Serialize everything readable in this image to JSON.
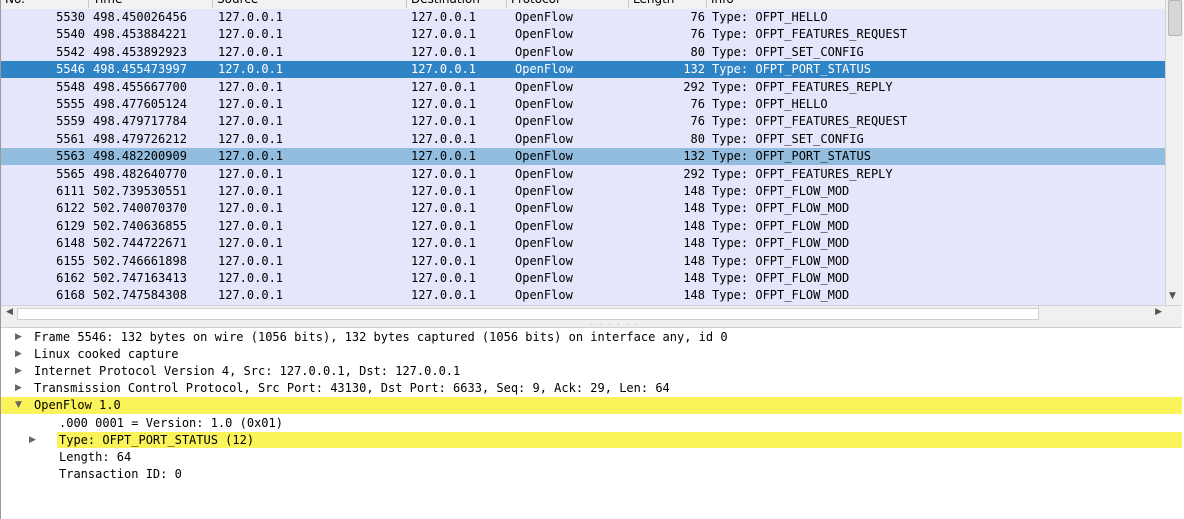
{
  "columns": [
    "No.",
    "Time",
    "Source",
    "Destination",
    "Protocol",
    "Length",
    "Info"
  ],
  "packets": [
    {
      "no": "5530",
      "time": "498.450026456",
      "src": "127.0.0.1",
      "dst": "127.0.0.1",
      "proto": "OpenFlow",
      "len": "76",
      "info": "Type: OFPT_HELLO"
    },
    {
      "no": "5540",
      "time": "498.453884221",
      "src": "127.0.0.1",
      "dst": "127.0.0.1",
      "proto": "OpenFlow",
      "len": "76",
      "info": "Type: OFPT_FEATURES_REQUEST"
    },
    {
      "no": "5542",
      "time": "498.453892923",
      "src": "127.0.0.1",
      "dst": "127.0.0.1",
      "proto": "OpenFlow",
      "len": "80",
      "info": "Type: OFPT_SET_CONFIG"
    },
    {
      "no": "5546",
      "time": "498.455473997",
      "src": "127.0.0.1",
      "dst": "127.0.0.1",
      "proto": "OpenFlow",
      "len": "132",
      "info": "Type: OFPT_PORT_STATUS"
    },
    {
      "no": "5548",
      "time": "498.455667700",
      "src": "127.0.0.1",
      "dst": "127.0.0.1",
      "proto": "OpenFlow",
      "len": "292",
      "info": "Type: OFPT_FEATURES_REPLY"
    },
    {
      "no": "5555",
      "time": "498.477605124",
      "src": "127.0.0.1",
      "dst": "127.0.0.1",
      "proto": "OpenFlow",
      "len": "76",
      "info": "Type: OFPT_HELLO"
    },
    {
      "no": "5559",
      "time": "498.479717784",
      "src": "127.0.0.1",
      "dst": "127.0.0.1",
      "proto": "OpenFlow",
      "len": "76",
      "info": "Type: OFPT_FEATURES_REQUEST"
    },
    {
      "no": "5561",
      "time": "498.479726212",
      "src": "127.0.0.1",
      "dst": "127.0.0.1",
      "proto": "OpenFlow",
      "len": "80",
      "info": "Type: OFPT_SET_CONFIG"
    },
    {
      "no": "5563",
      "time": "498.482200909",
      "src": "127.0.0.1",
      "dst": "127.0.0.1",
      "proto": "OpenFlow",
      "len": "132",
      "info": "Type: OFPT_PORT_STATUS"
    },
    {
      "no": "5565",
      "time": "498.482640770",
      "src": "127.0.0.1",
      "dst": "127.0.0.1",
      "proto": "OpenFlow",
      "len": "292",
      "info": "Type: OFPT_FEATURES_REPLY"
    },
    {
      "no": "6111",
      "time": "502.739530551",
      "src": "127.0.0.1",
      "dst": "127.0.0.1",
      "proto": "OpenFlow",
      "len": "148",
      "info": "Type: OFPT_FLOW_MOD"
    },
    {
      "no": "6122",
      "time": "502.740070370",
      "src": "127.0.0.1",
      "dst": "127.0.0.1",
      "proto": "OpenFlow",
      "len": "148",
      "info": "Type: OFPT_FLOW_MOD"
    },
    {
      "no": "6129",
      "time": "502.740636855",
      "src": "127.0.0.1",
      "dst": "127.0.0.1",
      "proto": "OpenFlow",
      "len": "148",
      "info": "Type: OFPT_FLOW_MOD"
    },
    {
      "no": "6148",
      "time": "502.744722671",
      "src": "127.0.0.1",
      "dst": "127.0.0.1",
      "proto": "OpenFlow",
      "len": "148",
      "info": "Type: OFPT_FLOW_MOD"
    },
    {
      "no": "6155",
      "time": "502.746661898",
      "src": "127.0.0.1",
      "dst": "127.0.0.1",
      "proto": "OpenFlow",
      "len": "148",
      "info": "Type: OFPT_FLOW_MOD"
    },
    {
      "no": "6162",
      "time": "502.747163413",
      "src": "127.0.0.1",
      "dst": "127.0.0.1",
      "proto": "OpenFlow",
      "len": "148",
      "info": "Type: OFPT_FLOW_MOD"
    },
    {
      "no": "6168",
      "time": "502.747584308",
      "src": "127.0.0.1",
      "dst": "127.0.0.1",
      "proto": "OpenFlow",
      "len": "148",
      "info": "Type: OFPT_FLOW_MOD"
    }
  ],
  "selected_no": "5546",
  "related_no": "5563",
  "details": [
    {
      "text": "Frame 5546: 132 bytes on wire (1056 bits), 132 bytes captured (1056 bits) on interface any, id 0",
      "expander": "collapsed",
      "indent": 0,
      "highlight": "none"
    },
    {
      "text": "Linux cooked capture",
      "expander": "collapsed",
      "indent": 0,
      "highlight": "none"
    },
    {
      "text": "Internet Protocol Version 4, Src: 127.0.0.1, Dst: 127.0.0.1",
      "expander": "collapsed",
      "indent": 0,
      "highlight": "none"
    },
    {
      "text": "Transmission Control Protocol, Src Port: 43130, Dst Port: 6633, Seq: 9, Ack: 29, Len: 64",
      "expander": "collapsed",
      "indent": 0,
      "highlight": "none"
    },
    {
      "text": "OpenFlow 1.0",
      "expander": "expanded",
      "indent": 0,
      "highlight": "full"
    },
    {
      "text": ".000 0001 = Version: 1.0 (0x01)",
      "expander": "none",
      "indent": 1,
      "highlight": "none"
    },
    {
      "text": "Type: OFPT_PORT_STATUS (12)",
      "expander": "collapsed",
      "indent": 1,
      "highlight": "text"
    },
    {
      "text": "Length: 64",
      "expander": "none",
      "indent": 1,
      "highlight": "none"
    },
    {
      "text": "Transaction ID: 0",
      "expander": "none",
      "indent": 1,
      "highlight": "none"
    }
  ],
  "colors": {
    "selected_row": "#2f84c5",
    "related_row": "#92bddf",
    "row_background": "#e5e5fb",
    "detail_highlight": "#fbf35a"
  },
  "icons": {
    "collapsed": "triangle-right-icon",
    "expanded": "triangle-down-icon",
    "scroll_left": "arrow-left-icon",
    "scroll_right": "arrow-right-icon",
    "scroll_down": "arrow-down-icon"
  }
}
